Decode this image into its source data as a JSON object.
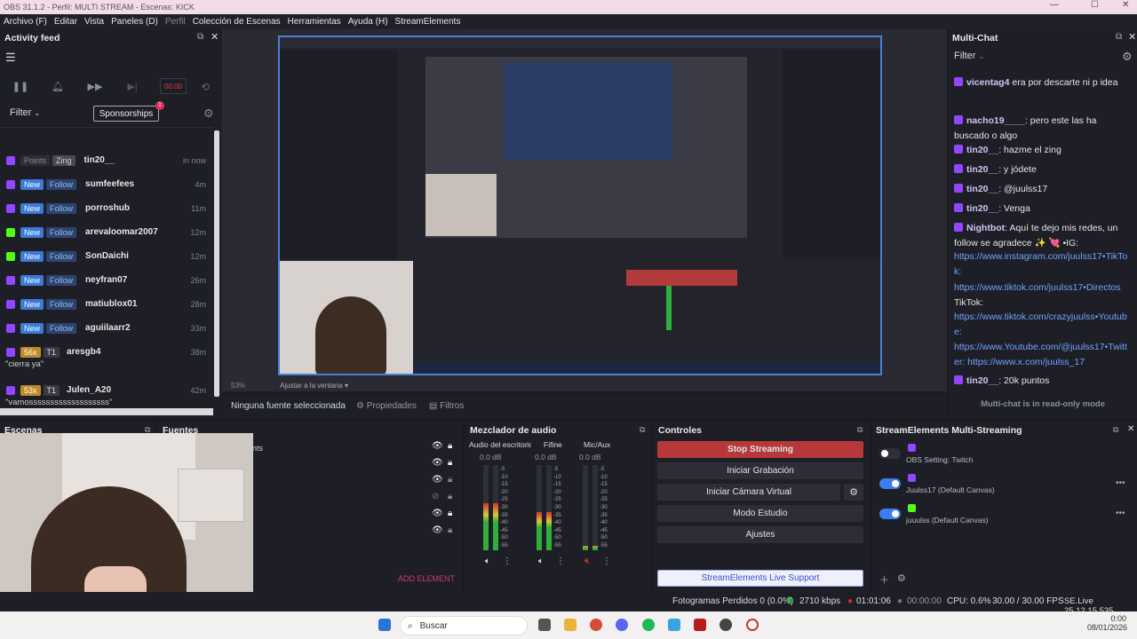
{
  "window": {
    "title": "OBS 31.1.2 - Perfil: MULTI STREAM - Escenas: KICK"
  },
  "menu": [
    "Archivo (F)",
    "Editar",
    "Vista",
    "Paneles (D)",
    "Perfil",
    "Colección de Escenas",
    "Herramientas",
    "Ayuda (H)",
    "StreamElements"
  ],
  "activity_feed": {
    "title": "Activity feed",
    "mute_label": "00:00",
    "filter_label": "Filter",
    "sponsorships_label": "Sponsorships",
    "sponsorships_count": "1",
    "items": [
      {
        "type": "points",
        "badge1": "Points",
        "badge2": "Zing",
        "user": "tin20__",
        "time": "in now",
        "icon_color": "#9146ff"
      },
      {
        "type": "follow",
        "badge1": "New",
        "badge2": "Follow",
        "user": "sumfeefees",
        "time": "4m",
        "icon_color": "#9146ff"
      },
      {
        "type": "follow",
        "badge1": "New",
        "badge2": "Follow",
        "user": "porroshub",
        "time": "11m",
        "icon_color": "#9146ff"
      },
      {
        "type": "follow",
        "badge1": "New",
        "badge2": "Follow",
        "user": "arevaloomar2007",
        "time": "12m",
        "icon_color": "#53fc18"
      },
      {
        "type": "follow",
        "badge1": "New",
        "badge2": "Follow",
        "user": "SonDaichi",
        "time": "12m",
        "icon_color": "#53fc18"
      },
      {
        "type": "follow",
        "badge1": "New",
        "badge2": "Follow",
        "user": "neyfran07",
        "time": "26m",
        "icon_color": "#9146ff"
      },
      {
        "type": "follow",
        "badge1": "New",
        "badge2": "Follow",
        "user": "matiublox01",
        "time": "28m",
        "icon_color": "#9146ff"
      },
      {
        "type": "follow",
        "badge1": "New",
        "badge2": "Follow",
        "user": "aguiilaarr2",
        "time": "33m",
        "icon_color": "#9146ff"
      },
      {
        "type": "sub",
        "badge1": "56x",
        "badge2": "T1",
        "user": "aresgb4",
        "time": "38m",
        "icon_color": "#9146ff",
        "message": "\"cierra ya\""
      },
      {
        "type": "sub",
        "badge1": "53x",
        "badge2": "T1",
        "user": "Julen_A20",
        "time": "42m",
        "icon_color": "#9146ff",
        "message": "\"vamosssssssssssssssssss\""
      }
    ]
  },
  "multichat": {
    "title": "Multi-Chat",
    "filter_label": "Filter",
    "footer": "Multi-chat is in read-only mode",
    "lines": [
      {
        "name": "vicentag4",
        "text": " era por descarte ni p idea"
      },
      {
        "name": "nacho19____",
        "text": ": pero este las ha buscado o algo"
      },
      {
        "name": "tin20__",
        "text": ": hazme el zing"
      },
      {
        "name": "tin20__",
        "text": ": y jódete"
      },
      {
        "name": "tin20__",
        "text": ": @juulss17"
      },
      {
        "name": "tin20__",
        "text": ": Venga"
      },
      {
        "name": "Nightbot",
        "text": ": Aquí te dejo mis redes, un follow se agradece ✨ 💘 •IG:"
      },
      {
        "link": "https://www.instagram.com/juulss17•TikTok:"
      },
      {
        "link": "https://www.tiktok.com/juulss17•Directos"
      },
      {
        "plain": "TikTok:"
      },
      {
        "link": "https://www.tiktok.com/crazyjuulss•Youtube:"
      },
      {
        "link": "https://www.Youtube.com/@juulss17•Twitter: https://www.x.com/juulss_17"
      },
      {
        "name": "tin20__",
        "text": ": 20k puntos"
      }
    ]
  },
  "source_bar": {
    "no_source": "Ninguna fuente seleccionada",
    "properties": "Propiedades",
    "filters": "Filtros",
    "zoom": "53%",
    "fit": "Ajustar a la ventana"
  },
  "docks": {
    "scenes_title": "Escenas",
    "sources_title": "Fuentes",
    "sources_fragment": "nts",
    "add_element": "ADD ELEMENT",
    "mixer_title": "Mezclador de audio",
    "mixer_channels": [
      {
        "name": "Audio del escritorio",
        "db": "0.0 dB",
        "level": 0.55
      },
      {
        "name": "Fifine",
        "db": "0.0 dB",
        "level": 0.45
      },
      {
        "name": "Mic/Aux",
        "db": "0.0 dB",
        "level": 0.05
      }
    ],
    "meter_ticks": [
      "-5",
      "-10",
      "-15",
      "-20",
      "-25",
      "-30",
      "-35",
      "-40",
      "-45",
      "-50",
      "-55"
    ],
    "controls_title": "Controles",
    "controls": {
      "stop_streaming": "Stop Streaming",
      "start_recording": "Iniciar Grabación",
      "virtual_cam": "Iniciar Cámara Virtual",
      "studio_mode": "Modo Estudio",
      "settings": "Ajustes",
      "support": "StreamElements Live Support"
    },
    "se_title": "StreamElements Multi-Streaming",
    "se_outputs": [
      {
        "label": "OBS Setting: Twitch",
        "enabled": false
      },
      {
        "label": "Juulss17 (Default Canvas)",
        "enabled": true
      },
      {
        "label": "juuulss (Default Canvas)",
        "enabled": true
      }
    ]
  },
  "status": {
    "dropped": "Fotogramas Perdidos 0 (0.0%)",
    "bitrate": "2710 kbps",
    "live_time": "01:01:06",
    "rec_time": "00:00:00",
    "cpu": "CPU: 0.6%",
    "fps": "30.00 / 30.00 FPS",
    "version": "SE.Live 25.12.15.535"
  },
  "taskbar": {
    "search": "Buscar",
    "time": "0:00",
    "date": "08/01/2026"
  }
}
